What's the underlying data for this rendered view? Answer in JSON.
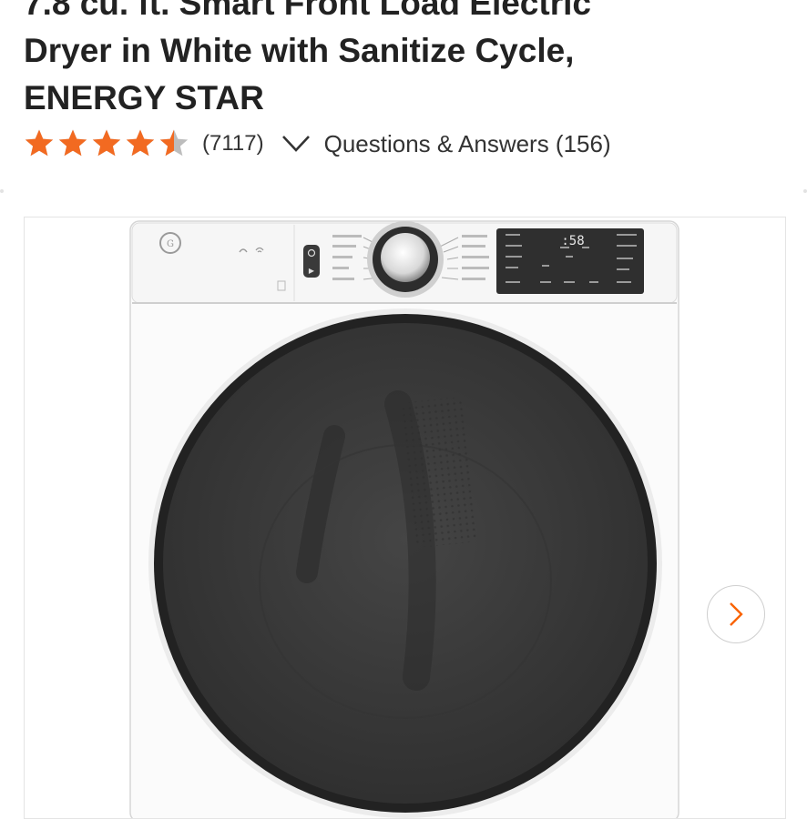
{
  "product": {
    "title_lines": [
      "7.8 cu. ft. Smart Front Load Electric",
      "Dryer in White with Sanitize Cycle,",
      "ENERGY STAR"
    ],
    "rating": 4.5,
    "rating_max": 5,
    "review_count": "(7117)",
    "qa_label": "Questions & Answers (156)"
  },
  "gallery": {
    "display_time": ":58",
    "next_icon": "chevron-right-icon"
  },
  "colors": {
    "star": "#f26a21",
    "star_empty": "#bdbdbd",
    "accent": "#f96302",
    "door": "#3a3a3a",
    "display": "#2f2f2f"
  }
}
